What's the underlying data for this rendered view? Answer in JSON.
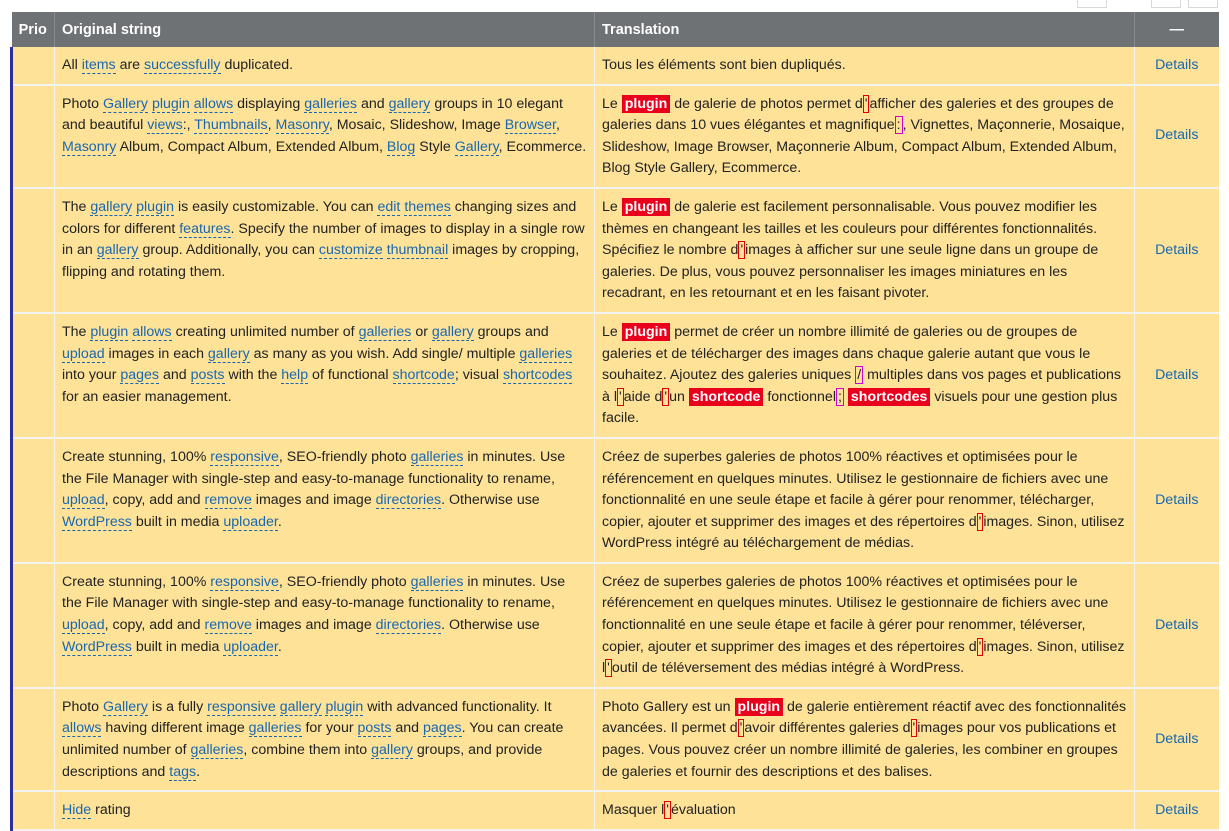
{
  "header": {
    "prio": "Prio",
    "original": "Original string",
    "translation": "Translation",
    "actions": "—"
  },
  "rows": [
    {
      "original": [
        [
          "t",
          "All "
        ],
        [
          "g",
          "items"
        ],
        [
          "t",
          " are "
        ],
        [
          "g",
          "successfully"
        ],
        [
          "t",
          " duplicated."
        ]
      ],
      "translation": [
        [
          "t",
          "Tous les éléments sont bien dupliqués."
        ]
      ],
      "action": "Details"
    },
    {
      "original": [
        [
          "t",
          "Photo "
        ],
        [
          "g",
          "Gallery"
        ],
        [
          "t",
          " "
        ],
        [
          "g",
          "plugin"
        ],
        [
          "t",
          " "
        ],
        [
          "g",
          "allows"
        ],
        [
          "t",
          " displaying "
        ],
        [
          "g",
          "galleries"
        ],
        [
          "t",
          " and "
        ],
        [
          "g",
          "gallery"
        ],
        [
          "t",
          " groups in 10 elegant and beautiful "
        ],
        [
          "g",
          "views"
        ],
        [
          "t",
          ":, "
        ],
        [
          "g",
          "Thumbnails"
        ],
        [
          "t",
          ", "
        ],
        [
          "g",
          "Masonry"
        ],
        [
          "t",
          ", Mosaic, Slideshow, Image "
        ],
        [
          "g",
          "Browser"
        ],
        [
          "t",
          ", "
        ],
        [
          "g",
          "Masonry"
        ],
        [
          "t",
          " Album, Compact Album, Extended Album, "
        ],
        [
          "g",
          "Blog"
        ],
        [
          "t",
          " Style "
        ],
        [
          "g",
          "Gallery"
        ],
        [
          "t",
          ", Ecommerce."
        ]
      ],
      "translation": [
        [
          "t",
          "Le "
        ],
        [
          "h",
          "plugin"
        ],
        [
          "t",
          " de galerie de photos permet d"
        ],
        [
          "w",
          "'"
        ],
        [
          "t",
          "afficher des galeries et des groupes de galeries dans 10 vues élégantes et magnifique"
        ],
        [
          "p",
          ":"
        ],
        [
          "t",
          ", Vignettes, Maçonnerie, Mosaique, Slideshow, Image Browser, Maçonnerie Album, Compact Album, Extended Album, Blog Style Gallery, Ecommerce."
        ]
      ],
      "action": "Details"
    },
    {
      "original": [
        [
          "t",
          "The "
        ],
        [
          "g",
          "gallery"
        ],
        [
          "t",
          " "
        ],
        [
          "g",
          "plugin"
        ],
        [
          "t",
          " is easily customizable. You can "
        ],
        [
          "g",
          "edit"
        ],
        [
          "t",
          " "
        ],
        [
          "g",
          "themes"
        ],
        [
          "t",
          " changing sizes and colors for different "
        ],
        [
          "g",
          "features"
        ],
        [
          "t",
          ". Specify the number of images to display in a single row in an "
        ],
        [
          "g",
          "gallery"
        ],
        [
          "t",
          " group. Additionally, you can "
        ],
        [
          "g",
          "customize"
        ],
        [
          "t",
          " "
        ],
        [
          "g",
          "thumbnail"
        ],
        [
          "t",
          " images by cropping, flipping and rotating them."
        ]
      ],
      "translation": [
        [
          "t",
          "Le "
        ],
        [
          "h",
          "plugin"
        ],
        [
          "t",
          " de galerie est facilement personnalisable. Vous pouvez modifier les thèmes en changeant les tailles et les couleurs pour différentes fonctionnalités. Spécifiez le nombre d"
        ],
        [
          "w",
          "'"
        ],
        [
          "t",
          "images à afficher sur une seule ligne dans un groupe de galeries. De plus, vous pouvez personnaliser les images miniatures en les recadrant, en les retournant et en les faisant pivoter."
        ]
      ],
      "action": "Details"
    },
    {
      "original": [
        [
          "t",
          "The "
        ],
        [
          "g",
          "plugin"
        ],
        [
          "t",
          " "
        ],
        [
          "g",
          "allows"
        ],
        [
          "t",
          " creating unlimited number of "
        ],
        [
          "g",
          "galleries"
        ],
        [
          "t",
          " or "
        ],
        [
          "g",
          "gallery"
        ],
        [
          "t",
          " groups and "
        ],
        [
          "g",
          "upload"
        ],
        [
          "t",
          " images in each "
        ],
        [
          "g",
          "gallery"
        ],
        [
          "t",
          " as many as you wish. Add single/ multiple "
        ],
        [
          "g",
          "galleries"
        ],
        [
          "t",
          " into your "
        ],
        [
          "g",
          "pages"
        ],
        [
          "t",
          " and "
        ],
        [
          "g",
          "posts"
        ],
        [
          "t",
          " with the "
        ],
        [
          "g",
          "help"
        ],
        [
          "t",
          " of functional "
        ],
        [
          "g",
          "shortcode"
        ],
        [
          "t",
          "; visual "
        ],
        [
          "g",
          "shortcodes"
        ],
        [
          "t",
          " for an easier management."
        ]
      ],
      "translation": [
        [
          "t",
          "Le "
        ],
        [
          "h",
          "plugin"
        ],
        [
          "t",
          " permet de créer un nombre illimité de galeries ou de groupes de galeries et de télécharger des images dans chaque galerie autant que vous le souhaitez. Ajoutez des galeries uniques "
        ],
        [
          "p",
          "/"
        ],
        [
          "t",
          " multiples dans vos pages et publications à l"
        ],
        [
          "w",
          "'"
        ],
        [
          "t",
          "aide d"
        ],
        [
          "w",
          "'"
        ],
        [
          "t",
          "un "
        ],
        [
          "h",
          "shortcode"
        ],
        [
          "t",
          " fonctionnel"
        ],
        [
          "p",
          ";"
        ],
        [
          "t",
          " "
        ],
        [
          "h",
          "shortcodes"
        ],
        [
          "t",
          " visuels pour une gestion plus facile."
        ]
      ],
      "action": "Details"
    },
    {
      "original": [
        [
          "t",
          "Create stunning, 100% "
        ],
        [
          "g",
          "responsive"
        ],
        [
          "t",
          ", SEO-friendly photo "
        ],
        [
          "g",
          "galleries"
        ],
        [
          "t",
          " in minutes. Use the File Manager with single-step and easy-to-manage functionality to rename, "
        ],
        [
          "g",
          "upload"
        ],
        [
          "t",
          ", copy, add and "
        ],
        [
          "g",
          "remove"
        ],
        [
          "t",
          " images and image "
        ],
        [
          "g",
          "directories"
        ],
        [
          "t",
          ". Otherwise use "
        ],
        [
          "g",
          "WordPress"
        ],
        [
          "t",
          " built in media "
        ],
        [
          "g",
          "uploader"
        ],
        [
          "t",
          "."
        ]
      ],
      "translation": [
        [
          "t",
          "Créez de superbes galeries de photos 100% réactives et optimisées pour le référencement en quelques minutes. Utilisez le gestionnaire de fichiers avec une fonctionnalité en une seule étape et facile à gérer pour renommer, télécharger, copier, ajouter et supprimer des images et des répertoires d"
        ],
        [
          "w",
          "'"
        ],
        [
          "t",
          "images. Sinon, utilisez WordPress intégré au téléchargement de médias."
        ]
      ],
      "action": "Details"
    },
    {
      "original": [
        [
          "t",
          "Create stunning, 100% "
        ],
        [
          "g",
          "responsive"
        ],
        [
          "t",
          ", SEO-friendly photo "
        ],
        [
          "g",
          "galleries"
        ],
        [
          "t",
          " in minutes. Use the File Manager with single-step and easy-to-manage functionality to rename, "
        ],
        [
          "g",
          "upload"
        ],
        [
          "t",
          ", copy, add and "
        ],
        [
          "g",
          "remove"
        ],
        [
          "t",
          " images and image "
        ],
        [
          "g",
          "directories"
        ],
        [
          "t",
          ". Otherwise use "
        ],
        [
          "g",
          "WordPress"
        ],
        [
          "t",
          " built in media "
        ],
        [
          "g",
          "uploader"
        ],
        [
          "t",
          "."
        ]
      ],
      "translation": [
        [
          "t",
          "Créez de superbes galeries de photos 100% réactives et optimisées pour le référencement en quelques minutes. Utilisez le gestionnaire de fichiers avec une fonctionnalité en une seule étape et facile à gérer pour renommer, téléverser, copier, ajouter et supprimer des images et des répertoires d"
        ],
        [
          "w",
          "'"
        ],
        [
          "t",
          "images. Sinon, utilisez l"
        ],
        [
          "w",
          "'"
        ],
        [
          "t",
          "outil de téléversement des médias intégré à WordPress."
        ]
      ],
      "action": "Details"
    },
    {
      "original": [
        [
          "t",
          "Photo "
        ],
        [
          "g",
          "Gallery"
        ],
        [
          "t",
          " is a fully "
        ],
        [
          "g",
          "responsive"
        ],
        [
          "t",
          " "
        ],
        [
          "g",
          "gallery"
        ],
        [
          "t",
          " "
        ],
        [
          "g",
          "plugin"
        ],
        [
          "t",
          " with advanced functionality. It "
        ],
        [
          "g",
          "allows"
        ],
        [
          "t",
          " having different image "
        ],
        [
          "g",
          "galleries"
        ],
        [
          "t",
          " for your "
        ],
        [
          "g",
          "posts"
        ],
        [
          "t",
          " and "
        ],
        [
          "g",
          "pages"
        ],
        [
          "t",
          ". You can create unlimited number of "
        ],
        [
          "g",
          "galleries"
        ],
        [
          "t",
          ", combine them into "
        ],
        [
          "g",
          "gallery"
        ],
        [
          "t",
          " groups, and provide descriptions and "
        ],
        [
          "g",
          "tags"
        ],
        [
          "t",
          "."
        ]
      ],
      "translation": [
        [
          "t",
          "Photo Gallery est un "
        ],
        [
          "h",
          "plugin"
        ],
        [
          "t",
          " de galerie entièrement réactif avec des fonctionnalités avancées. Il permet d"
        ],
        [
          "w",
          "'"
        ],
        [
          "t",
          "avoir différentes galeries d"
        ],
        [
          "w",
          "'"
        ],
        [
          "t",
          "images pour vos publications et pages. Vous pouvez créer un nombre illimité de galeries, les combiner en groupes de galeries et fournir des descriptions et des balises."
        ]
      ],
      "action": "Details"
    },
    {
      "original": [
        [
          "g",
          "Hide"
        ],
        [
          "t",
          " rating"
        ]
      ],
      "translation": [
        [
          "t",
          "Masquer l"
        ],
        [
          "w",
          "'"
        ],
        [
          "t",
          "évaluation"
        ]
      ],
      "action": "Details"
    }
  ]
}
